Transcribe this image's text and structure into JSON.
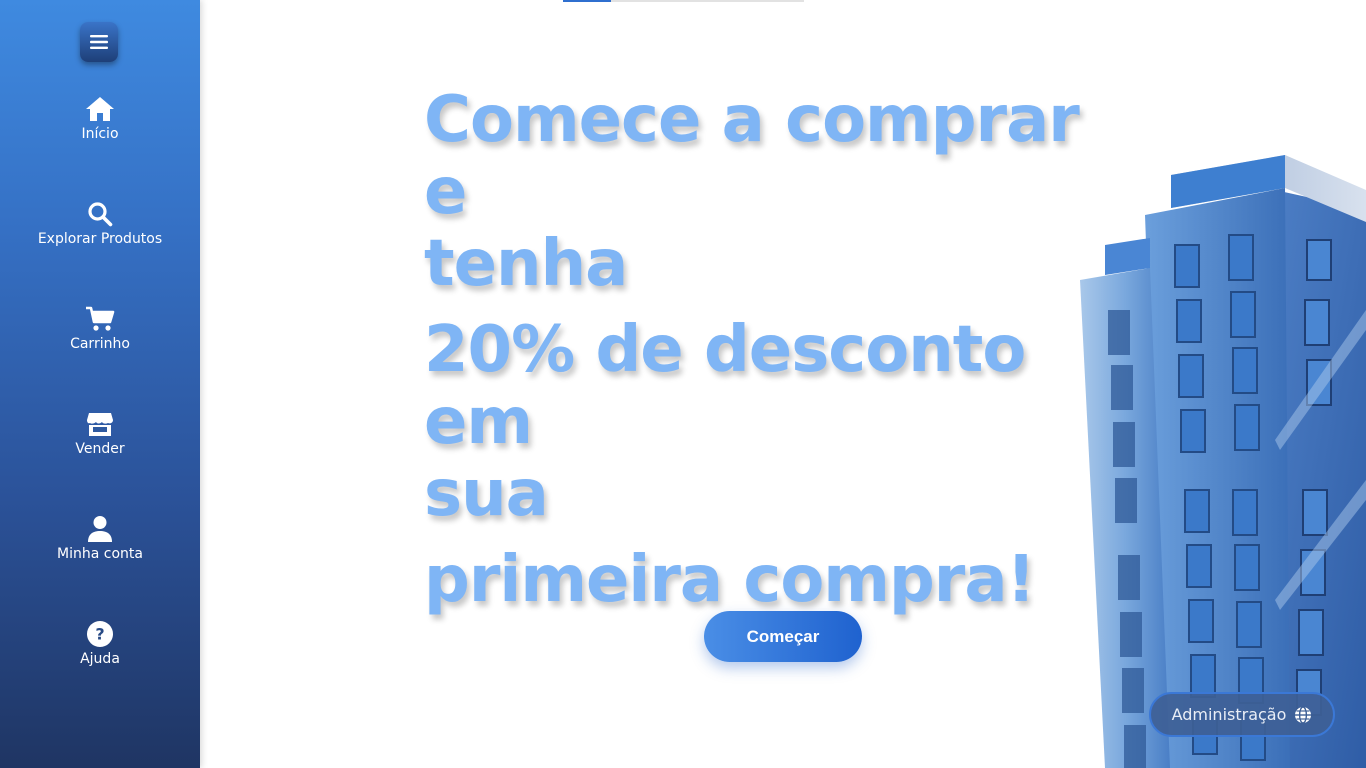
{
  "sidebar": {
    "menu_icon": "hamburger-icon",
    "items": [
      {
        "label": "Início",
        "icon": "home-icon"
      },
      {
        "label": "Explorar Produtos",
        "icon": "search-icon"
      },
      {
        "label": "Carrinho",
        "icon": "cart-icon"
      },
      {
        "label": "Vender",
        "icon": "store-icon"
      },
      {
        "label": "Minha conta",
        "icon": "user-icon"
      },
      {
        "label": "Ajuda",
        "icon": "help-icon"
      }
    ]
  },
  "hero": {
    "line1": "Comece a comprar e",
    "line2": "tenha",
    "line3": "20% de desconto em",
    "line4": "sua",
    "line5": "primeira compra!",
    "cta_label": "Começar"
  },
  "admin": {
    "label": "Administração",
    "icon": "globe-icon"
  },
  "colors": {
    "headline": "#7fb5f5",
    "sidebar_top": "#3f8ae0",
    "sidebar_bottom": "#1f3563",
    "accent": "#2f6fcf"
  }
}
